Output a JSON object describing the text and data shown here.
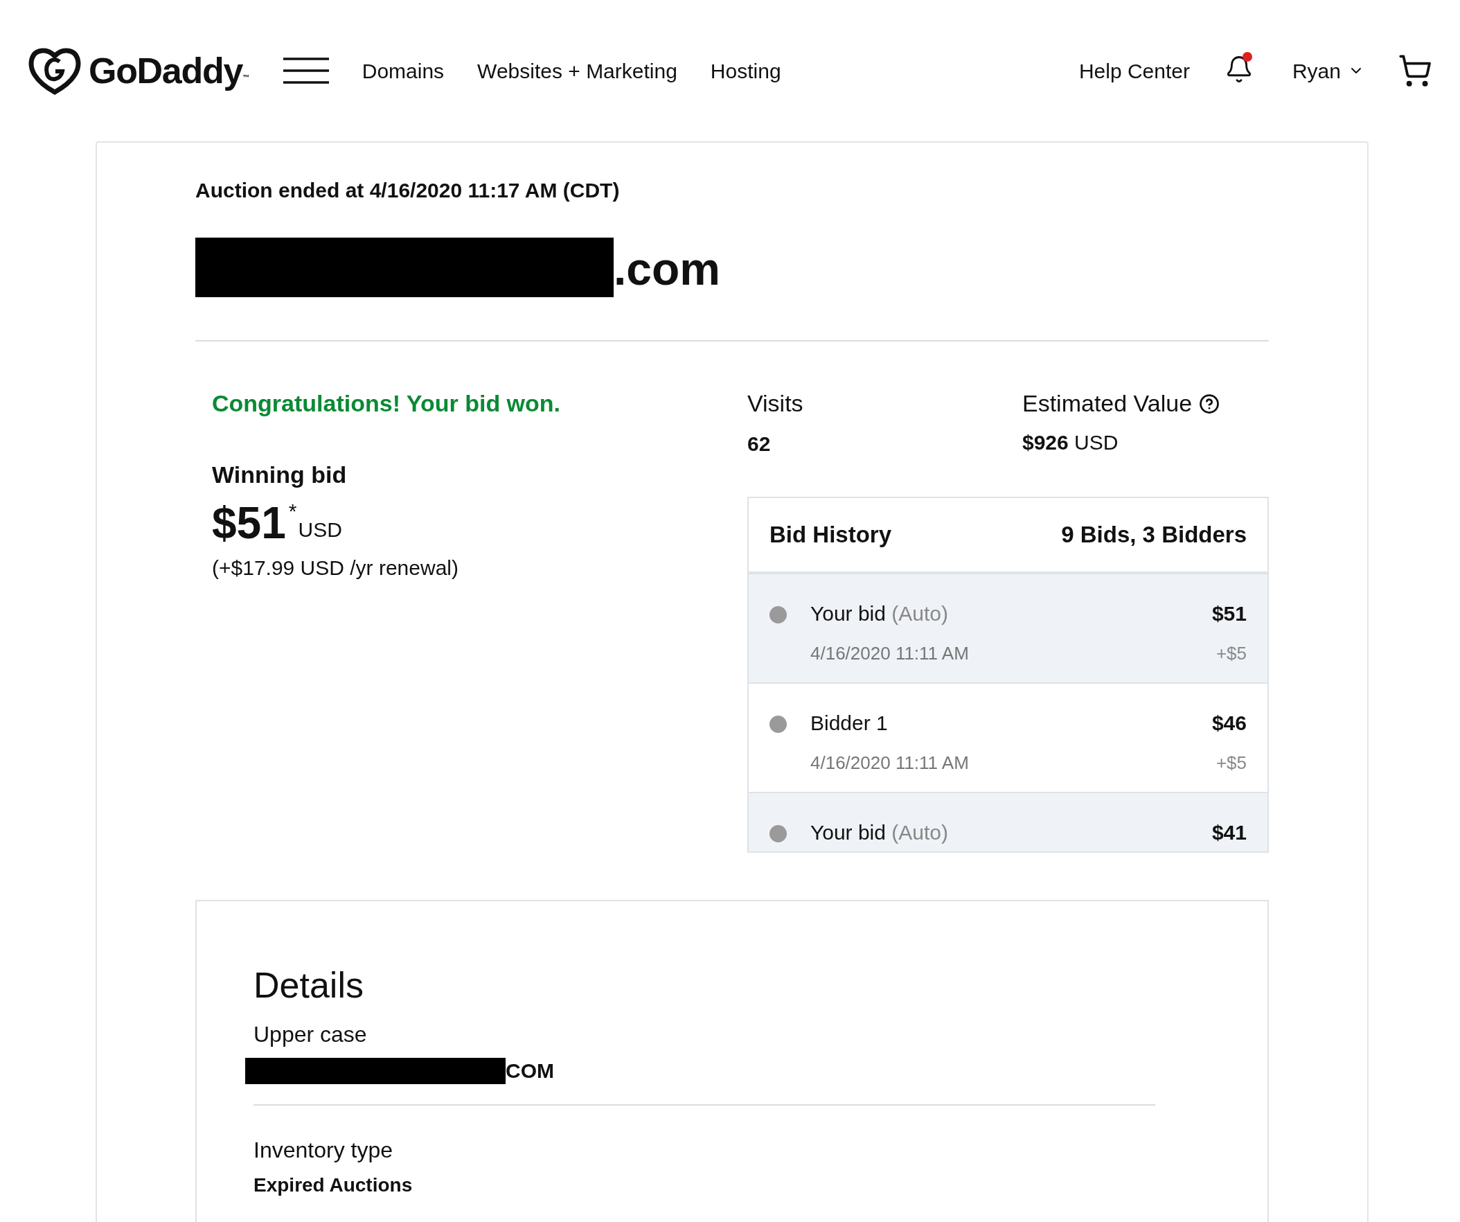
{
  "header": {
    "logo": {
      "name": "GoDaddy",
      "mark": "™"
    },
    "nav": [
      "Domains",
      "Websites + Marketing",
      "Hosting"
    ],
    "help": "Help Center",
    "notification": {
      "unread": true
    },
    "user": "Ryan"
  },
  "auction": {
    "ended": "Auction ended at 4/16/2020 11:17 AM (CDT)",
    "domain_suffix": ".com",
    "result": "Congratulations! Your bid won.",
    "winning_label": "Winning bid",
    "amount": "$51",
    "footnote": "*",
    "currency": "USD",
    "renewal": "(+$17.99 USD /yr renewal)",
    "visits": {
      "label": "Visits",
      "value": "62"
    },
    "estimated": {
      "label": "Estimated Value",
      "amount": "$926",
      "currency": "USD"
    },
    "bid_history": {
      "title": "Bid History",
      "summary": "9 Bids, 3 Bidders",
      "rows": [
        {
          "name": "Your bid",
          "note": "(Auto)",
          "date": "4/16/2020 11:11 AM",
          "amount": "$51",
          "increment": "+$5",
          "highlighted": true
        },
        {
          "name": "Bidder 1",
          "date": "4/16/2020 11:11 AM",
          "amount": "$46",
          "increment": "+$5",
          "highlighted": false
        },
        {
          "name": "Your bid",
          "note": "(Auto)",
          "amount": "$41",
          "highlighted": true
        }
      ]
    }
  },
  "details": {
    "title": "Details",
    "items": [
      {
        "label": "Upper case",
        "value": "COM",
        "redacted": true
      },
      {
        "label": "Inventory type",
        "value": "Expired Auctions",
        "redacted": false
      }
    ]
  }
}
